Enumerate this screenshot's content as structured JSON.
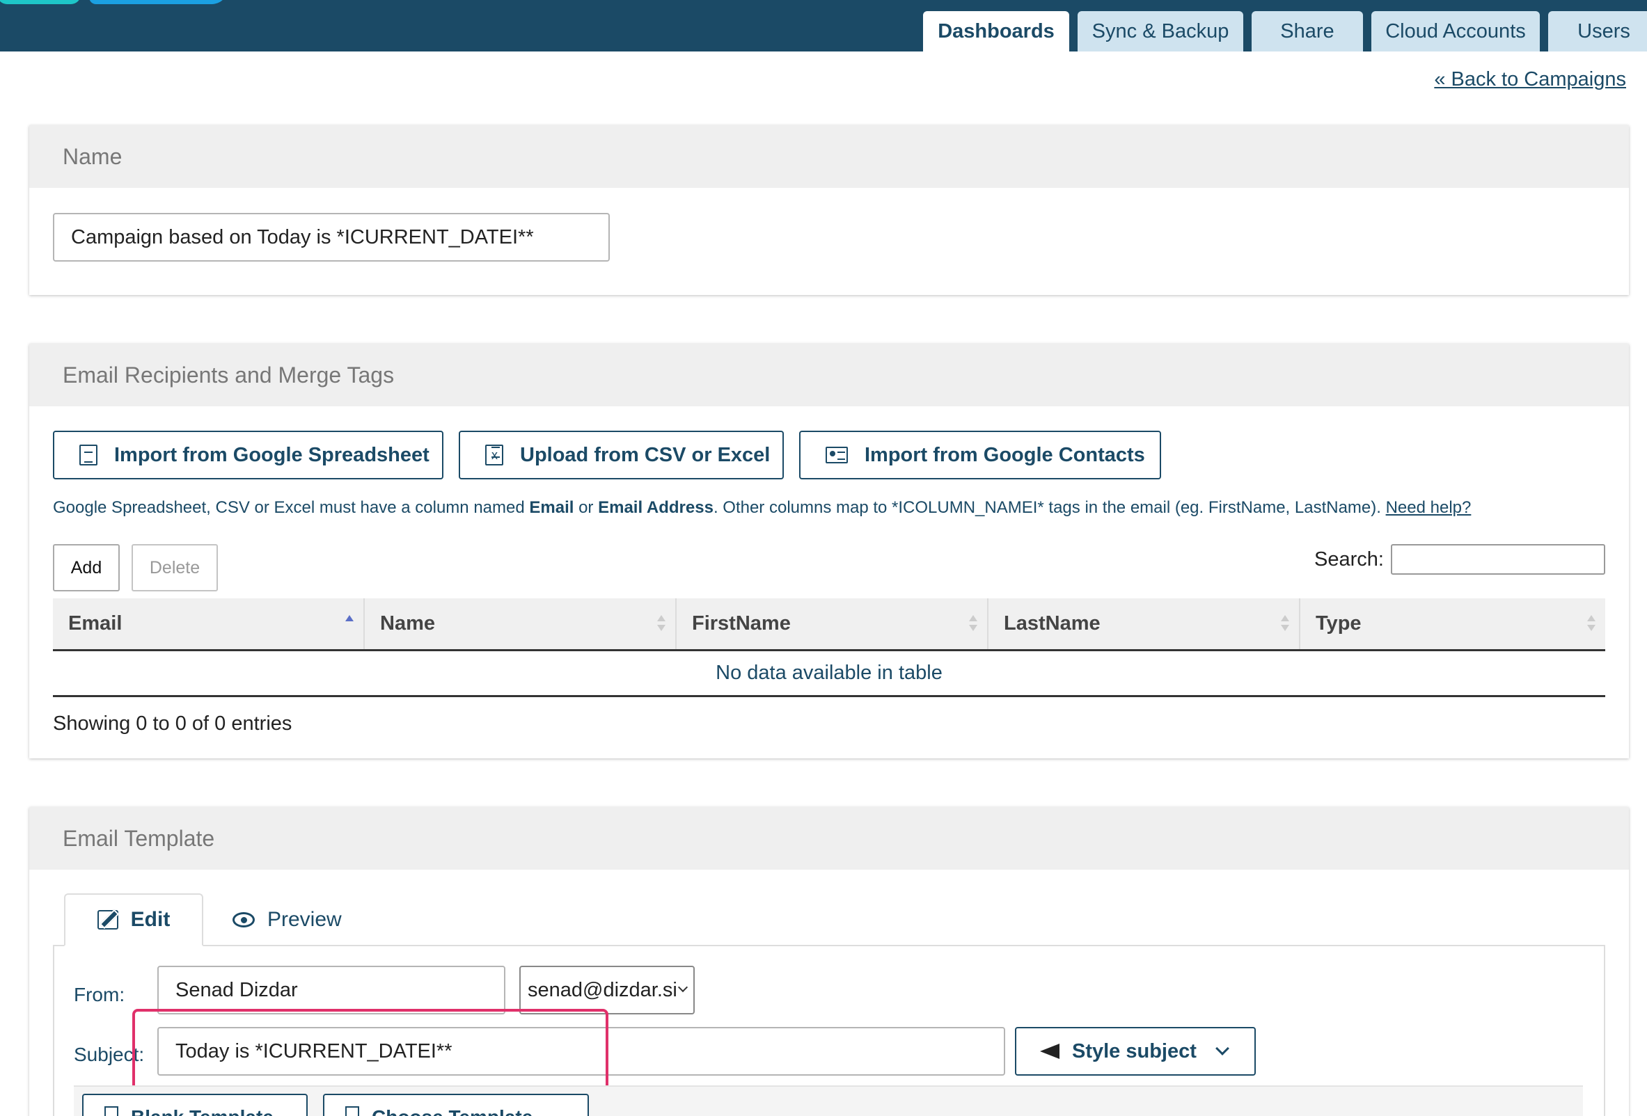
{
  "header": {
    "tabs": [
      {
        "label": "Dashboards",
        "active": true
      },
      {
        "label": "Sync & Backup",
        "active": false
      },
      {
        "label": "Share",
        "active": false
      },
      {
        "label": "Cloud Accounts",
        "active": false
      },
      {
        "label": "Users",
        "active": false
      }
    ],
    "back_link": "« Back to Campaigns"
  },
  "name_panel": {
    "title": "Name",
    "value": "Campaign based on Today is *ICURRENT_DATEI**"
  },
  "recipients_panel": {
    "title": "Email Recipients and Merge Tags",
    "import_buttons": {
      "spreadsheet": "Import from Google Spreadsheet",
      "csv": "Upload from CSV or Excel",
      "contacts": "Import from Google Contacts"
    },
    "info": {
      "part1": "Google Spreadsheet, CSV or Excel must have a column named ",
      "email": "Email",
      "or": " or ",
      "email_address": "Email Address",
      "part2": ". Other columns map to *ICOLUMN_NAMEI* tags in the email (eg. FirstName, LastName). ",
      "help": "Need help?"
    },
    "add_label": "Add",
    "delete_label": "Delete",
    "search_label": "Search:",
    "search_value": "",
    "columns": [
      "Email",
      "Name",
      "FirstName",
      "LastName",
      "Type"
    ],
    "empty_message": "No data available in table",
    "showing": "Showing 0 to 0 of 0 entries"
  },
  "template_panel": {
    "title": "Email Template",
    "tabs": {
      "edit": "Edit",
      "preview": "Preview"
    },
    "from_label": "From:",
    "from_name": "Senad Dizdar",
    "from_email": "senad@dizdar.si",
    "subject_label": "Subject:",
    "subject_value": "Today is *ICURRENT_DATEI**",
    "style_subject": "Style subject",
    "template_buttons": {
      "blank": "Blank Template",
      "choose": "Choose Template"
    }
  },
  "colors": {
    "header_bg": "#1b4a66",
    "accent": "#1b4a66",
    "highlight": "#e0306a"
  }
}
